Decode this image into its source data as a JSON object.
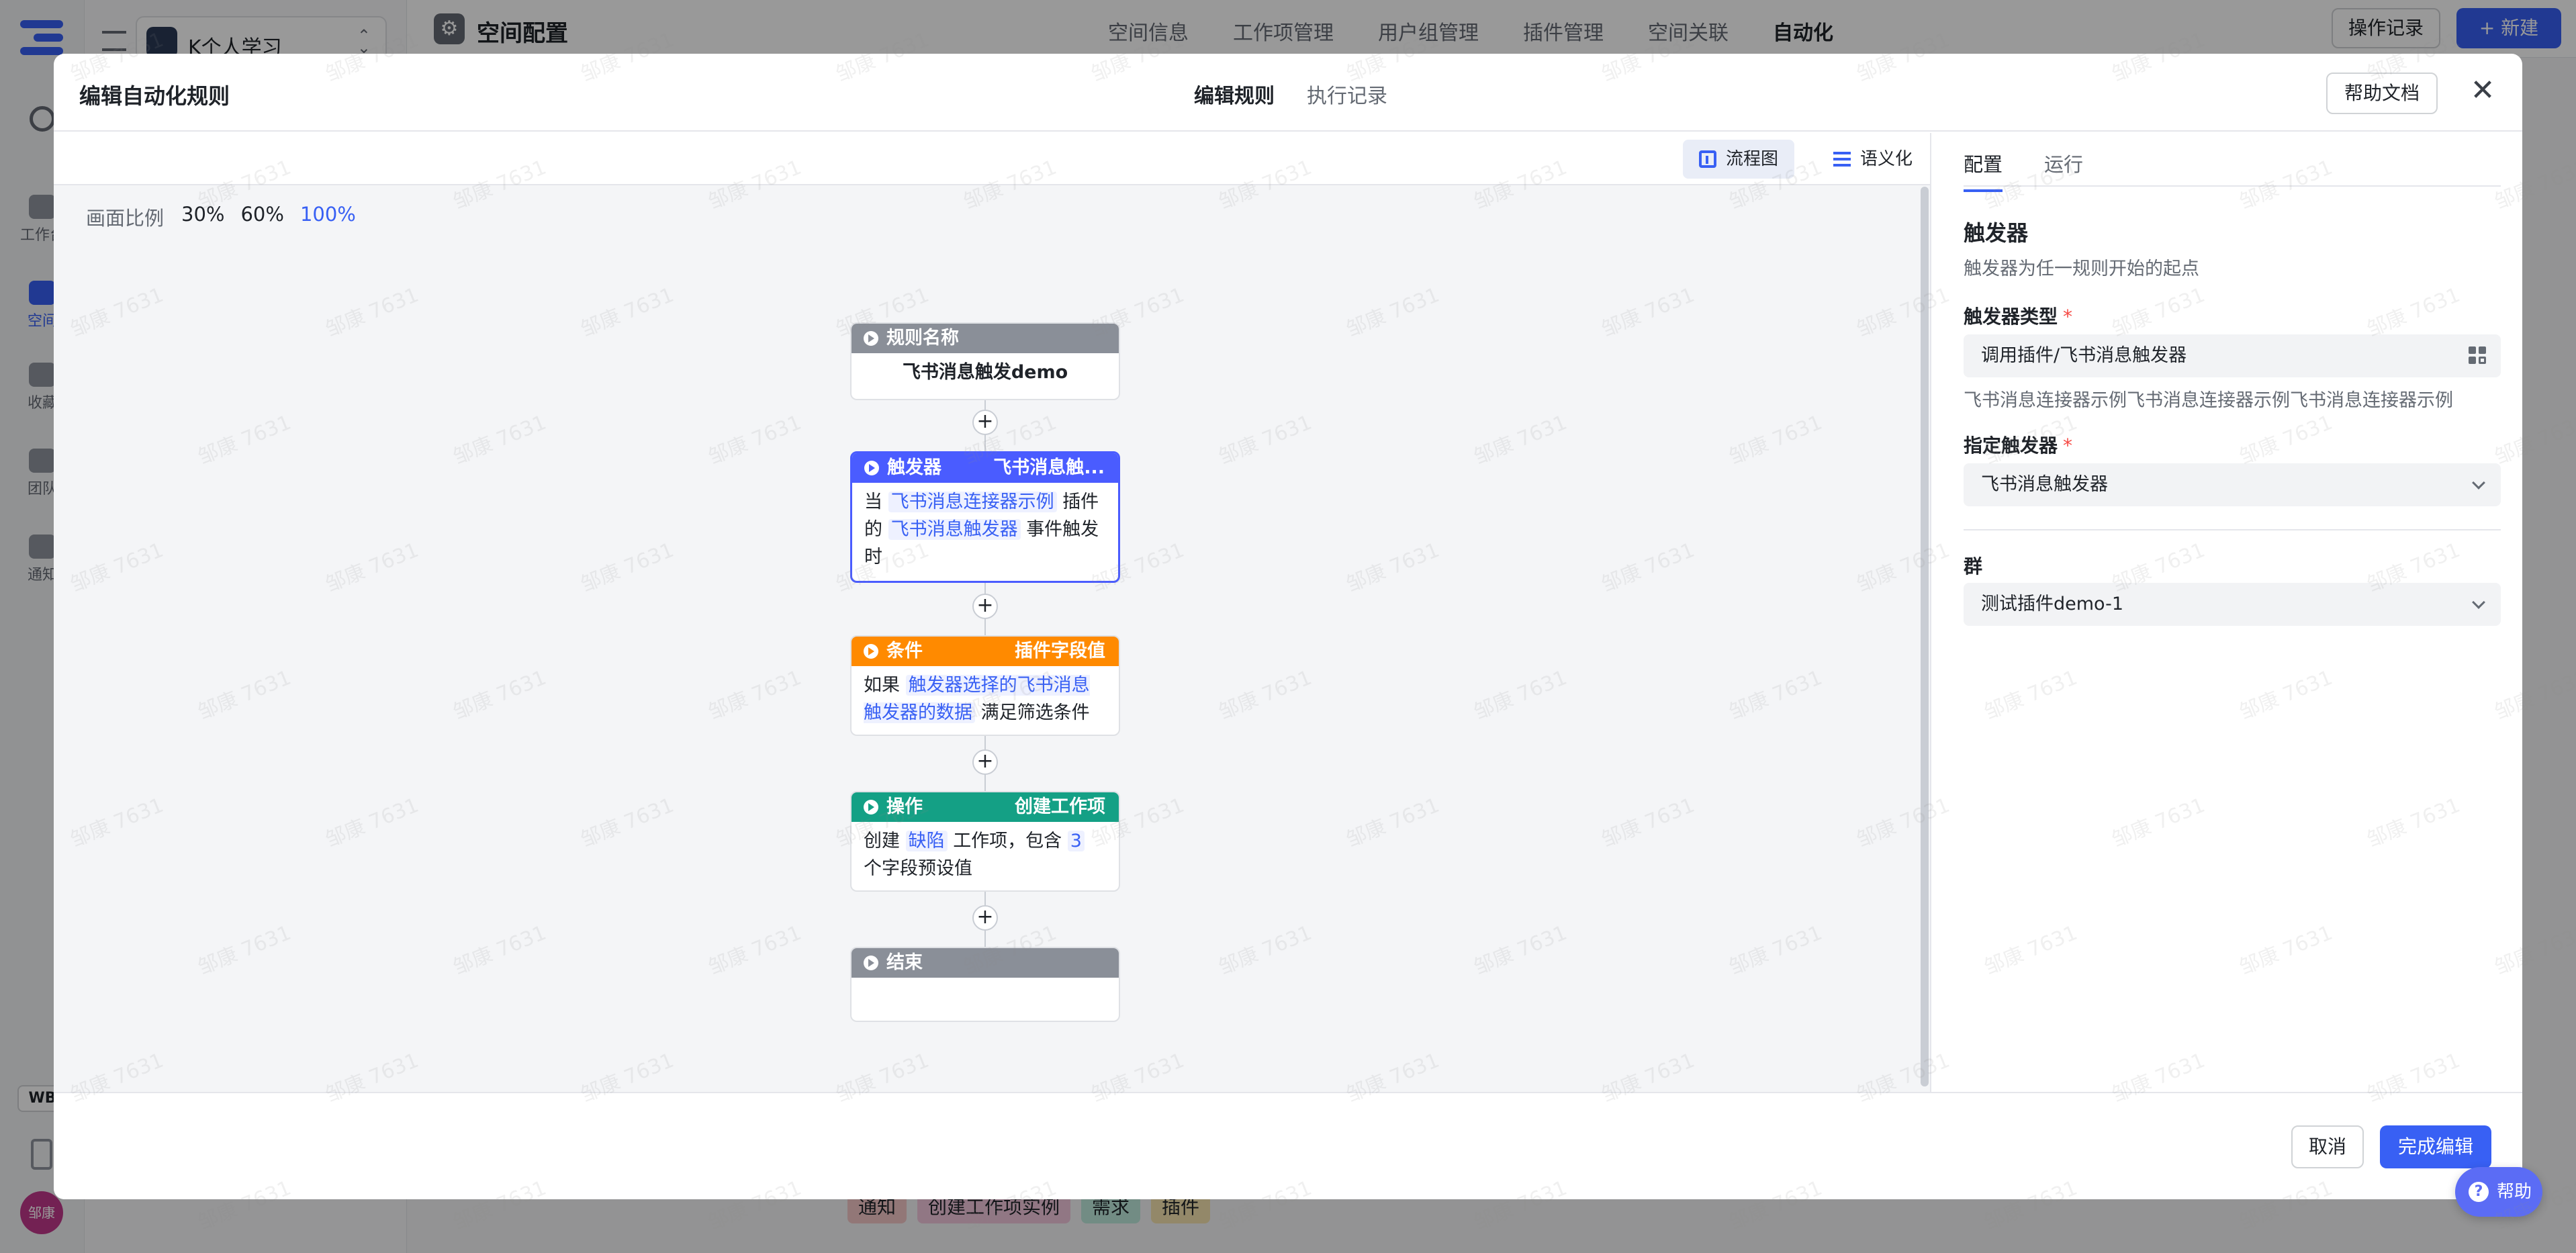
{
  "background": {
    "workspace_name": "K个人学习",
    "rail": [
      {
        "label": "工作台",
        "active": false
      },
      {
        "label": "空间",
        "active": true
      },
      {
        "label": "收藏",
        "active": false
      },
      {
        "label": "团队",
        "active": false
      },
      {
        "label": "通知",
        "active": false
      }
    ],
    "wb_badge": "WB",
    "avatar_text": "邹康",
    "page_title": "空间配置",
    "nav": [
      "空间信息",
      "工作项管理",
      "用户组管理",
      "插件管理",
      "空间关联",
      "自动化"
    ],
    "nav_active": "自动化",
    "oplog_button": "操作记录",
    "new_button": "+ 新建",
    "tags": [
      {
        "label": "通知",
        "color": "#f4c7c7"
      },
      {
        "label": "创建工作项实例",
        "color": "#f2c7dd"
      },
      {
        "label": "需求",
        "color": "#bfe9dd"
      },
      {
        "label": "插件",
        "color": "#f5e3b0"
      }
    ]
  },
  "modal": {
    "title": "编辑自动化规则",
    "tabs": [
      {
        "label": "编辑规则",
        "active": true
      },
      {
        "label": "执行记录",
        "active": false
      }
    ],
    "help_doc_button": "帮助文档",
    "close_icon": "close-icon",
    "view_modes": [
      {
        "label": "流程图",
        "icon": "flowchart-icon",
        "active": true
      },
      {
        "label": "语义化",
        "icon": "list-icon",
        "active": false
      }
    ],
    "zoom": {
      "label": "画面比例",
      "options": [
        "30%",
        "60%",
        "100%"
      ],
      "active": "100%"
    },
    "flow": {
      "rule_name": {
        "header": "规则名称",
        "text": "飞书消息触发demo"
      },
      "trigger": {
        "header": "触发器",
        "sub": "飞书消息触...",
        "parts": [
          "当",
          "飞书消息连接器示例",
          "插件的",
          "飞书消息触发器",
          "事件触发时"
        ]
      },
      "condition": {
        "header": "条件",
        "sub": "插件字段值",
        "parts": [
          "如果",
          "触发器选择的飞书消息触发器的数据",
          "满足筛选条件"
        ]
      },
      "action": {
        "header": "操作",
        "sub": "创建工作项",
        "parts": [
          "创建",
          "缺陷",
          "工作项，包含",
          "3",
          "个字段预设值"
        ]
      },
      "end": {
        "header": "结束"
      },
      "plus_symbol": "+"
    },
    "panel": {
      "tabs": [
        {
          "label": "配置",
          "active": true
        },
        {
          "label": "运行",
          "active": false
        }
      ],
      "section_title": "触发器",
      "section_subtitle": "触发器为任一规则开始的起点",
      "trigger_type_label": "触发器类型",
      "trigger_type_value": "调用插件/飞书消息触发器",
      "trigger_type_help": "飞书消息连接器示例飞书消息连接器示例飞书消息连接器示例",
      "specified_trigger_label": "指定触发器",
      "specified_trigger_value": "飞书消息触发器",
      "group_label": "群",
      "group_value": "测试插件demo-1",
      "required_mark": "*"
    },
    "footer": {
      "cancel": "取消",
      "done": "完成编辑"
    }
  },
  "help_float": {
    "label": "帮助",
    "icon": "?"
  },
  "watermark": "邹康 7631"
}
